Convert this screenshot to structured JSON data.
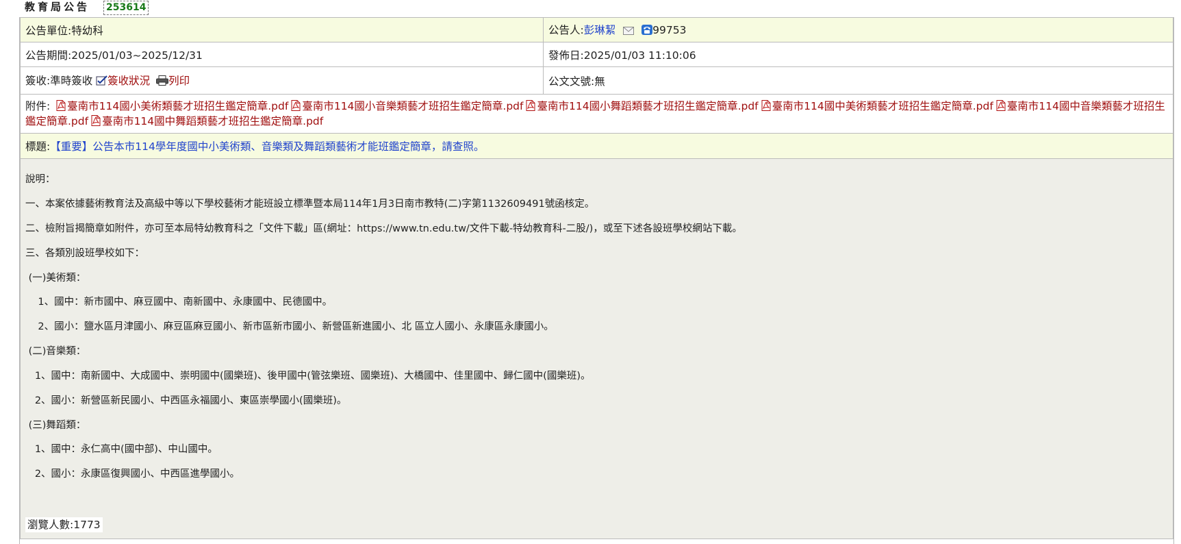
{
  "header": {
    "title": "教育局公告",
    "announcement_id": "253614"
  },
  "meta": {
    "unit": "公告單位:特幼科",
    "announcer_label": "公告人:",
    "announcer_name": "彭琳絜",
    "phone": "99753",
    "period": "公告期間:2025/01/03~2025/12/31",
    "published": "發佈日:2025/01/03 11:10:06",
    "sign": "簽收:準時簽收",
    "sign_status_link": "簽收狀況",
    "print_link": "列印",
    "doc_no": "公文文號:無"
  },
  "attachments": {
    "label": "附件:",
    "files": [
      "臺南市114國小美術類藝才班招生鑑定簡章.pdf",
      "臺南市114國小音樂類藝才班招生鑑定簡章.pdf",
      "臺南市114國小舞蹈類藝才班招生鑑定簡章.pdf",
      "臺南市114國中美術類藝才班招生鑑定簡章.pdf",
      "臺南市114國中音樂類藝才班招生鑑定簡章.pdf",
      "臺南市114國中舞蹈類藝才班招生鑑定簡章.pdf"
    ]
  },
  "subject": {
    "label": "標題:",
    "text": "【重要】公告本市114學年度國中小美術類、音樂類及舞蹈類藝術才能班鑑定簡章，請查照。"
  },
  "body": {
    "lines": [
      "說明：",
      "一、本案依據藝術教育法及高級中等以下學校藝術才能班設立標準暨本局114年1月3日南市教特(二)字第1132609491號函核定。",
      "二、檢附旨揭簡章如附件，亦可至本局特幼教育科之「文件下載」區(網址：https://www.tn.edu.tw/文件下載-特幼教育科-二股/)，或至下述各設班學校網站下載。",
      "三、各類別設班學校如下：",
      " (一)美術類：",
      "    1、國中：新市國中、麻豆國中、南新國中、永康國中、民德國中。",
      "    2、國小：鹽水區月津國小、麻豆區麻豆國小、新市區新市國小、新營區新進國小、北 區立人國小、永康區永康國小。",
      " (二)音樂類：",
      "   1、國中：南新國中、大成國中、崇明國中(國樂班)、後甲國中(管弦樂班、國樂班)、大橋國中、佳里國中、歸仁國中(國樂班)。",
      "   2、國小：新營區新民國小、中西區永福國小、東區崇學國小(國樂班)。",
      " (三)舞蹈類：",
      "   1、國中：永仁高中(國中部)、中山國中。",
      "   2、國小：永康區復興國小、中西區進學國小。"
    ],
    "views": "瀏覽人數:1773"
  }
}
